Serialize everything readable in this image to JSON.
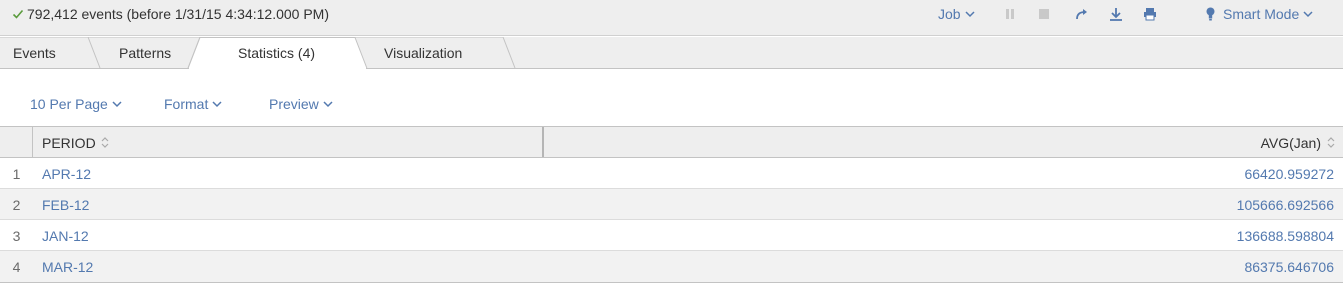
{
  "status": {
    "text": "792,412 events (before 1/31/15 4:34:12.000 PM)",
    "icon": "check-icon",
    "color": "#5a9b3c"
  },
  "toolbar": {
    "job_label": "Job",
    "icons": [
      "pause-icon",
      "stop-icon",
      "share-icon",
      "export-icon",
      "print-icon"
    ],
    "mode_label": "Smart Mode"
  },
  "tabs": [
    {
      "label": "Events",
      "active": false
    },
    {
      "label": "Patterns",
      "active": false
    },
    {
      "label": "Statistics (4)",
      "active": true
    },
    {
      "label": "Visualization",
      "active": false
    }
  ],
  "controls": {
    "per_page": "10 Per Page",
    "format": "Format",
    "preview": "Preview"
  },
  "table": {
    "columns": [
      "PERIOD",
      "AVG(Jan)"
    ],
    "rows": [
      {
        "num": "1",
        "period": "APR-12",
        "avg": "66420.959272"
      },
      {
        "num": "2",
        "period": "FEB-12",
        "avg": "105666.692566"
      },
      {
        "num": "3",
        "period": "JAN-12",
        "avg": "136688.598804"
      },
      {
        "num": "4",
        "period": "MAR-12",
        "avg": "86375.646706"
      }
    ]
  },
  "colors": {
    "accent": "#5379af",
    "bar_bg": "#eeeeee",
    "row_alt": "#f2f2f2"
  }
}
